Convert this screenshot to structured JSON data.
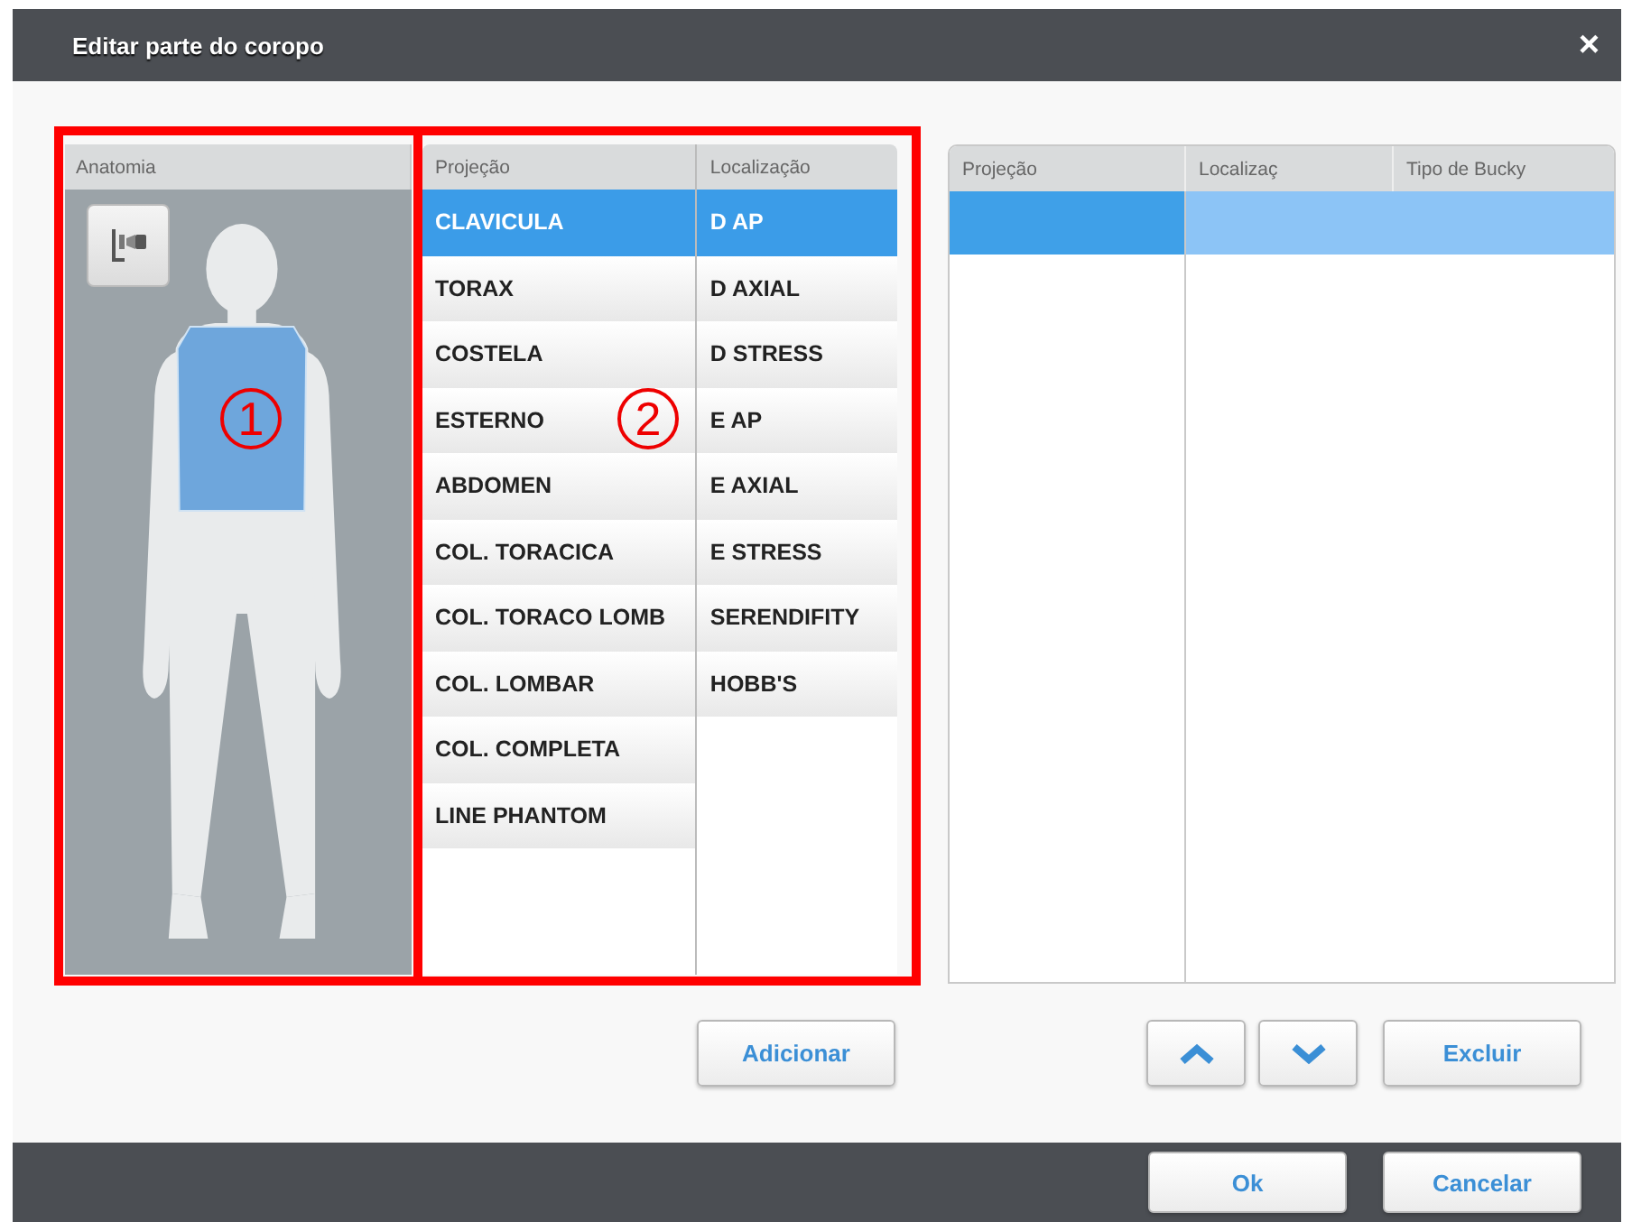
{
  "window": {
    "title": "Editar parte do coropo",
    "close": "×"
  },
  "anatomy": {
    "header": "Anatomia"
  },
  "markers": [
    "1",
    "2"
  ],
  "projection_table": {
    "columns": [
      "Projeção",
      "Localização"
    ],
    "projections": [
      {
        "label": "CLAVICULA",
        "selected": true
      },
      {
        "label": "TORAX",
        "selected": false
      },
      {
        "label": "COSTELA",
        "selected": false
      },
      {
        "label": "ESTERNO",
        "selected": false
      },
      {
        "label": "ABDOMEN",
        "selected": false
      },
      {
        "label": "COL. TORACICA",
        "selected": false
      },
      {
        "label": "COL. TORACO LOMB",
        "selected": false
      },
      {
        "label": "COL. LOMBAR",
        "selected": false
      },
      {
        "label": "COL. COMPLETA",
        "selected": false
      },
      {
        "label": "LINE PHANTOM",
        "selected": false
      }
    ],
    "locations": [
      {
        "label": "D AP",
        "selected": true
      },
      {
        "label": "D AXIAL",
        "selected": false
      },
      {
        "label": "D STRESS",
        "selected": false
      },
      {
        "label": "E AP",
        "selected": false
      },
      {
        "label": "E AXIAL",
        "selected": false
      },
      {
        "label": "E STRESS",
        "selected": false
      },
      {
        "label": "SERENDIFITY",
        "selected": false
      },
      {
        "label": "HOBB'S",
        "selected": false
      }
    ]
  },
  "selection_table": {
    "columns": [
      "Projeção",
      "Localizaç",
      "Tipo de Bucky"
    ],
    "rows": [
      {
        "selected": true
      }
    ]
  },
  "buttons": {
    "add": "Adicionar",
    "delete": "Excluir"
  },
  "footer": {
    "ok": "Ok",
    "cancel": "Cancelar"
  }
}
